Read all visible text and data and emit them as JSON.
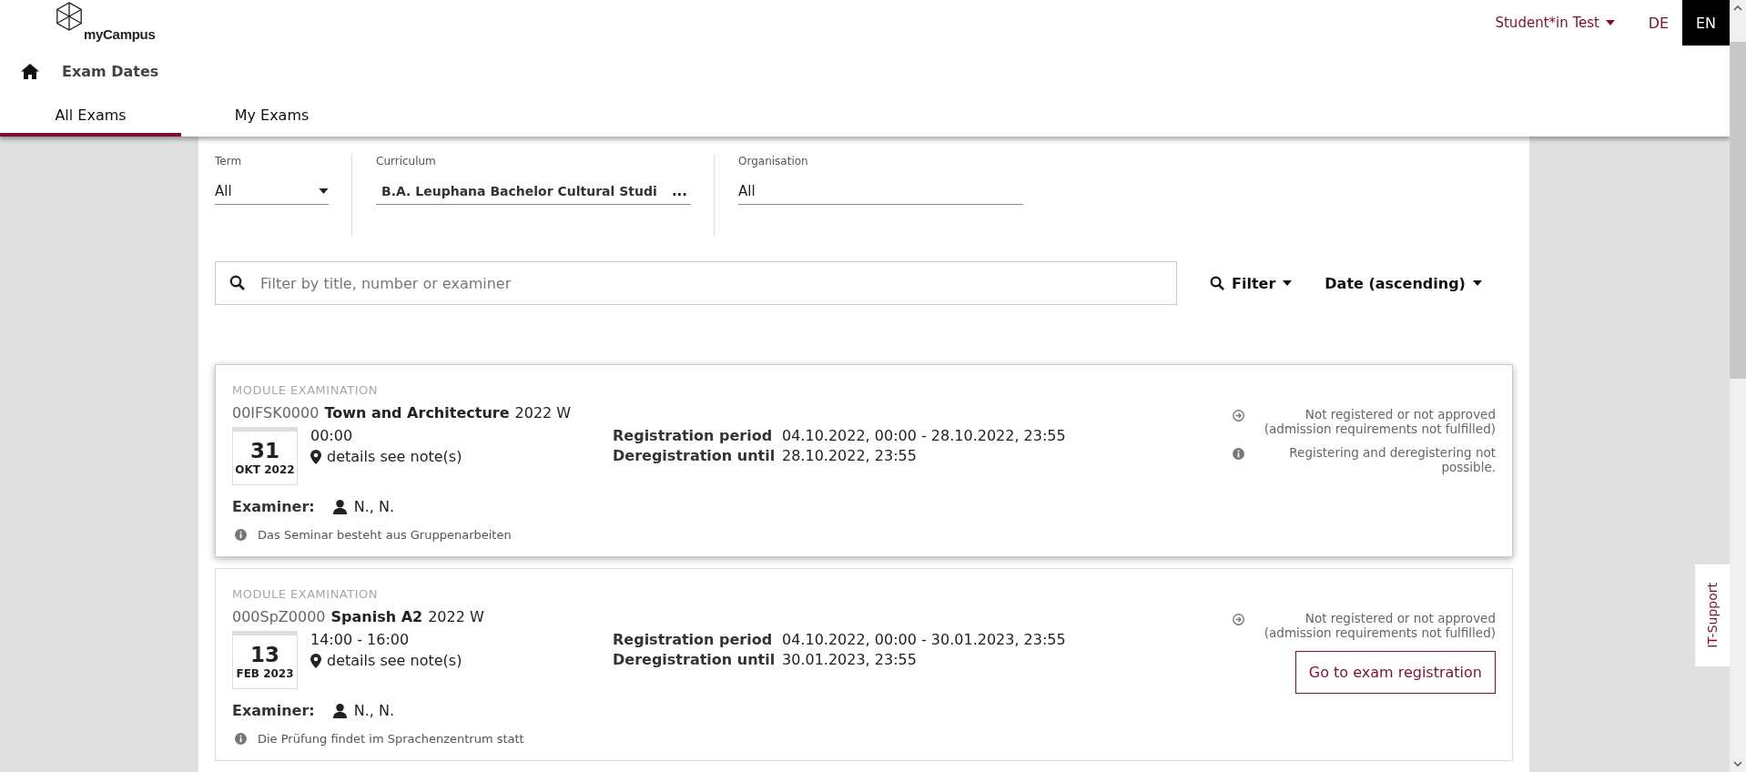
{
  "header": {
    "logo": "myCampus",
    "user": "Student*in Test",
    "languages": [
      {
        "label": "DE",
        "selected": false
      },
      {
        "label": "EN",
        "selected": true
      }
    ],
    "page_title": "Exam Dates"
  },
  "tabs": [
    {
      "label": "All Exams",
      "selected": true
    },
    {
      "label": "My Exams",
      "selected": false
    }
  ],
  "filters": [
    {
      "label": "Term",
      "value": "All",
      "kind": "select"
    },
    {
      "label": "Curriculum",
      "value": "B.A. Leuphana Bachelor Cultural Studi",
      "suffix": "...",
      "kind": "text"
    },
    {
      "label": "Organisation",
      "value": "All",
      "kind": "plain"
    }
  ],
  "search": {
    "placeholder": "Filter by title, number or examiner"
  },
  "filter_button": "Filter",
  "sort": "Date (ascending)",
  "exams": [
    {
      "type": "MODULE EXAMINATION",
      "number": "00IFSK0000",
      "title": "Town and Architecture",
      "term": "2022 W",
      "day": "31",
      "month": "OKT 2022",
      "time": "00:00",
      "location": "details see note(s)",
      "registration_label": "Registration period",
      "registration": "04.10.2022, 00:00 - 28.10.2022, 23:55",
      "deregistration_label": "Deregistration until",
      "deregistration": "28.10.2022, 23:55",
      "examiner_label": "Examiner:",
      "examiner": "N., N.",
      "note": "Das Seminar besteht aus Gruppenarbeiten",
      "highlighted": true,
      "status": [
        {
          "kind": "arrow",
          "text": "Not registered or not approved (admission requirements not fulfilled)"
        },
        {
          "kind": "info",
          "text": "Registering and deregistering not possible."
        }
      ]
    },
    {
      "type": "MODULE EXAMINATION",
      "number": "000SpZ0000",
      "title": "Spanish A2",
      "term": "2022 W",
      "day": "13",
      "month": "FEB 2023",
      "time": "14:00 - 16:00",
      "location": "details see note(s)",
      "registration_label": "Registration period",
      "registration": "04.10.2022, 00:00 - 30.01.2023, 23:55",
      "deregistration_label": "Deregistration until",
      "deregistration": "30.01.2023, 23:55",
      "examiner_label": "Examiner:",
      "examiner": "N., N.",
      "note": "Die Prüfung findet im Sprachenzentrum statt",
      "highlighted": false,
      "status": [
        {
          "kind": "arrow",
          "text": "Not registered or not approved (admission requirements not fulfilled)"
        },
        {
          "kind": "button",
          "text": "Go to exam registration"
        }
      ]
    }
  ],
  "side_tab": "IT-Support"
}
